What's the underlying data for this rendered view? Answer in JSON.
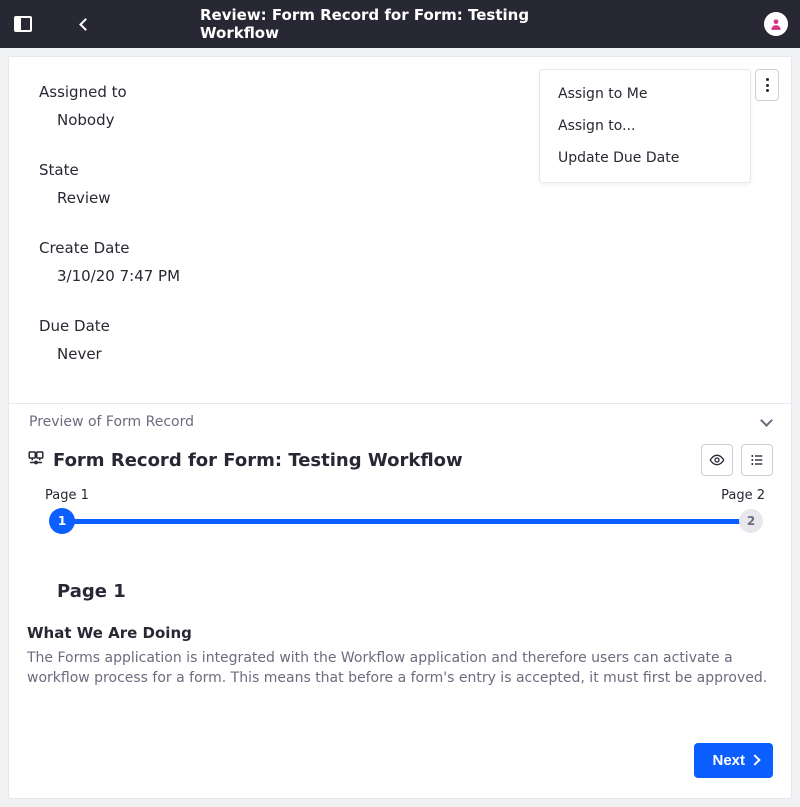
{
  "header": {
    "title": "Review: Form Record for Form: Testing Workflow"
  },
  "fields": {
    "assigned_to": {
      "label": "Assigned to",
      "value": "Nobody"
    },
    "state": {
      "label": "State",
      "value": "Review"
    },
    "create_date": {
      "label": "Create Date",
      "value": "3/10/20 7:47 PM"
    },
    "due_date": {
      "label": "Due Date",
      "value": "Never"
    }
  },
  "menu": {
    "items": [
      {
        "label": "Assign to Me"
      },
      {
        "label": "Assign to..."
      },
      {
        "label": "Update Due Date"
      }
    ]
  },
  "preview": {
    "header": "Preview of Form Record",
    "record_title": "Form Record for Form: Testing Workflow",
    "steps": [
      {
        "label": "Page 1",
        "num": "1"
      },
      {
        "label": "Page 2",
        "num": "2"
      }
    ],
    "page_heading": "Page 1",
    "section_heading": "What We Are Doing",
    "body_text": "The Forms application is integrated with the Workflow application and therefore users can activate a workflow process for a form. This means that before a form's entry is accepted, it must first be approved.",
    "next_label": "Next"
  },
  "colors": {
    "accent": "#0b5fff",
    "user_accent": "#d63384"
  }
}
